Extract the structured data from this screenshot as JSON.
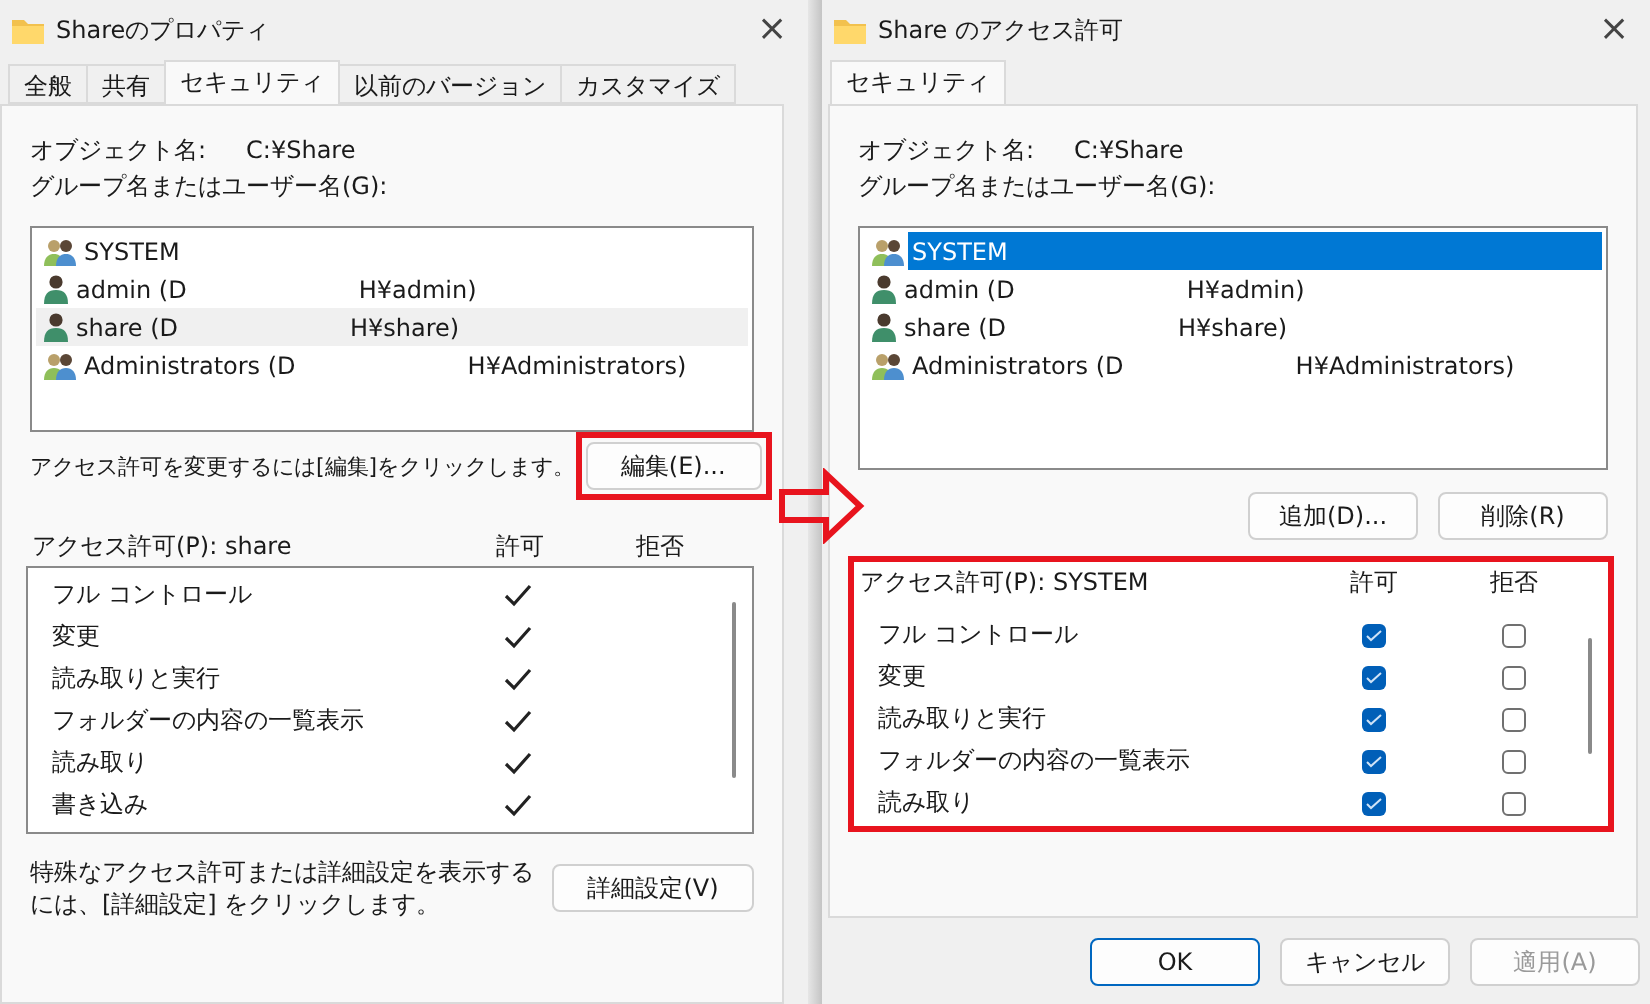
{
  "left_dialog": {
    "title": "Shareのプロパティ",
    "close": "×",
    "tabs": [
      {
        "label": "全般",
        "selected": false
      },
      {
        "label": "共有",
        "selected": false
      },
      {
        "label": "セキュリティ",
        "selected": true
      },
      {
        "label": "以前のバージョン",
        "selected": false
      },
      {
        "label": "カスタマイズ",
        "selected": false
      }
    ],
    "object_label": "オブジェクト名:",
    "object_value": "C:¥Share",
    "group_label": "グループ名またはユーザー名(G):",
    "principals": [
      {
        "kind": "group",
        "parts": [
          "SYSTEM"
        ],
        "selected": false
      },
      {
        "kind": "user",
        "parts": [
          "admin (D",
          "H¥admin)"
        ],
        "selected": false
      },
      {
        "kind": "user",
        "parts": [
          "share (D",
          "H¥share)"
        ],
        "selected": true
      },
      {
        "kind": "group",
        "parts": [
          "Administrators (D",
          "H¥Administrators)"
        ],
        "selected": false
      }
    ],
    "edit_hint": "アクセス許可を変更するには[編集]をクリックします。",
    "edit_button": {
      "label": "編集(E)...",
      "highlighted": true
    },
    "permissions_header": "アクセス許可(P): share",
    "allow_header": "許可",
    "deny_header": "拒否",
    "permissions": [
      {
        "name": "フル コントロール",
        "allow": true
      },
      {
        "name": "変更",
        "allow": true
      },
      {
        "name": "読み取りと実行",
        "allow": true
      },
      {
        "name": "フォルダーの内容の一覧表示",
        "allow": true
      },
      {
        "name": "読み取り",
        "allow": true
      },
      {
        "name": "書き込み",
        "allow": true
      }
    ],
    "advanced_hint": [
      "特殊なアクセス許可または詳細設定を表示する",
      "には、[詳細設定] をクリックします。"
    ],
    "advanced_button": "詳細設定(V)"
  },
  "right_dialog": {
    "title": "Share のアクセス許可",
    "close": "×",
    "tabs": [
      {
        "label": "セキュリティ",
        "selected": true
      }
    ],
    "object_label": "オブジェクト名:",
    "object_value": "C:¥Share",
    "group_label": "グループ名またはユーザー名(G):",
    "principals": [
      {
        "kind": "group",
        "parts": [
          "SYSTEM"
        ],
        "selected": true
      },
      {
        "kind": "user",
        "parts": [
          "admin (D",
          "H¥admin)"
        ],
        "selected": false
      },
      {
        "kind": "user",
        "parts": [
          "share (D",
          "H¥share)"
        ],
        "selected": false
      },
      {
        "kind": "group",
        "parts": [
          "Administrators (D",
          "H¥Administrators)"
        ],
        "selected": false
      }
    ],
    "add_button": "追加(D)...",
    "remove_button": "削除(R)",
    "permissions_highlighted": true,
    "permissions_header": "アクセス許可(P): SYSTEM",
    "allow_header": "許可",
    "deny_header": "拒否",
    "permissions": [
      {
        "name": "フル コントロール",
        "allow": true,
        "deny": false
      },
      {
        "name": "変更",
        "allow": true,
        "deny": false
      },
      {
        "name": "読み取りと実行",
        "allow": true,
        "deny": false
      },
      {
        "name": "フォルダーの内容の一覧表示",
        "allow": true,
        "deny": false
      },
      {
        "name": "読み取り",
        "allow": true,
        "deny": false
      }
    ],
    "buttons": [
      {
        "label": "OK",
        "kind": "default",
        "disabled": false
      },
      {
        "label": "キャンセル",
        "kind": "normal",
        "disabled": false
      },
      {
        "label": "適用(A)",
        "kind": "normal",
        "disabled": true
      }
    ]
  }
}
